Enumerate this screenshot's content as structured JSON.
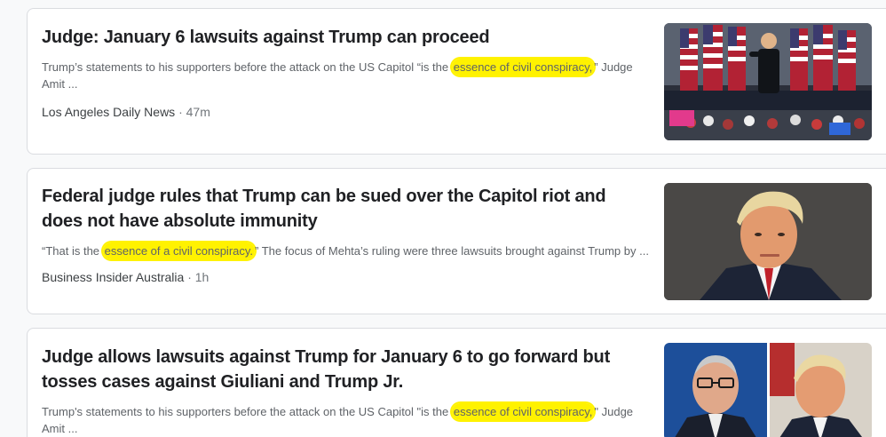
{
  "articles": [
    {
      "headline": "Judge: January 6 lawsuits against Trump can proceed",
      "snippet_before": "Trump’s statements to his supporters before the attack on the US Capitol “is the ",
      "snippet_highlight": "essence of civil conspiracy,",
      "snippet_after": "” Judge Amit ...",
      "source": "Los Angeles Daily News",
      "separator": " · ",
      "time": "47m",
      "image_description": "Trump on stage with American flags"
    },
    {
      "headline": "Federal judge rules that Trump can be sued over the Capitol riot and does not have absolute immunity",
      "snippet_before": "“That is the ",
      "snippet_highlight": "essence of a civil conspiracy.",
      "snippet_after": "” The focus of Mehta’s ruling were three lawsuits brought against Trump by ...",
      "source": "Business Insider Australia",
      "separator": " · ",
      "time": "1h",
      "image_description": "Trump portrait"
    },
    {
      "headline": "Judge allows lawsuits against Trump for January 6 to go forward but tosses cases against Giuliani and Trump Jr.",
      "snippet_before": "Trump's statements to his supporters before the attack on the US Capitol \"is the ",
      "snippet_highlight": "essence of civil conspiracy,",
      "snippet_after": "\" Judge Amit ...",
      "source": "",
      "separator": "",
      "time": "",
      "image_description": "Giuliani and Trump side by side"
    }
  ],
  "colors": {
    "highlight": "#fff200",
    "headline": "#202124",
    "snippet": "#5f6368",
    "source": "#3c4043"
  }
}
